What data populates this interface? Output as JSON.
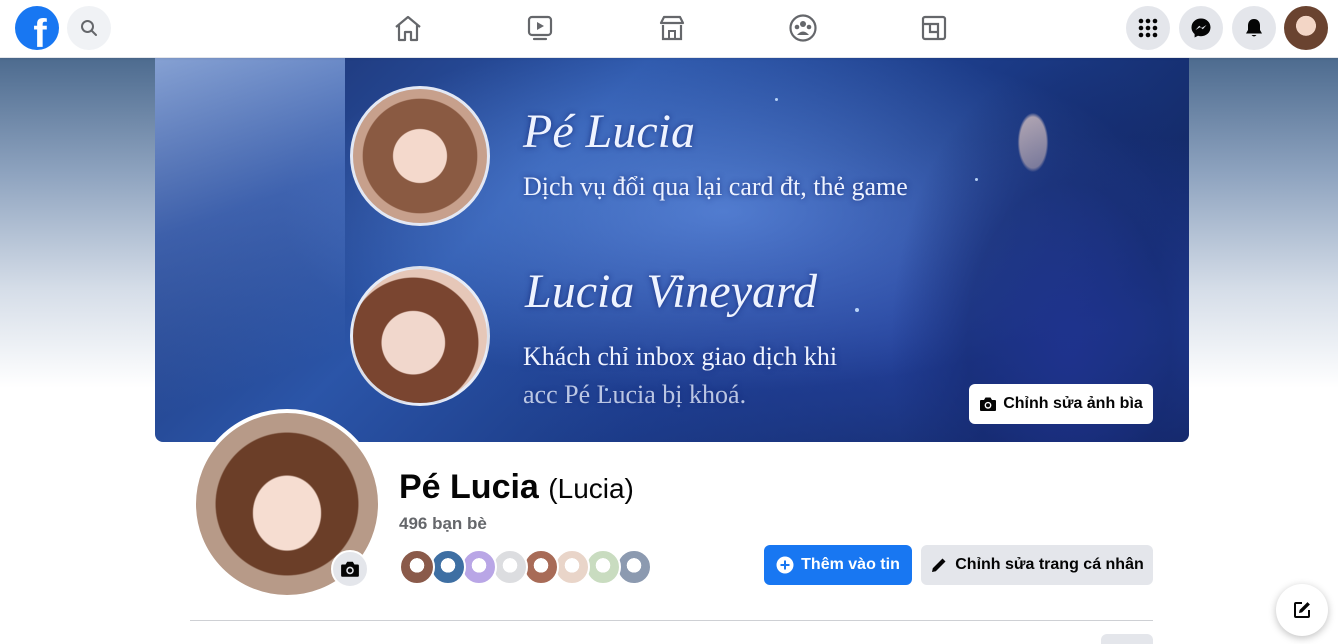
{
  "nav": {
    "logo_icon": "facebook-logo",
    "logo_letter": "f",
    "brand_color": "#1877f2",
    "center_icons": [
      "home-icon",
      "video-icon",
      "marketplace-icon",
      "groups-icon",
      "gaming-icon"
    ],
    "right_icons": [
      "menu-grid-icon",
      "messenger-icon",
      "notifications-icon"
    ]
  },
  "cover": {
    "title_1": "Pé Lucia",
    "subtitle_1": "Dịch vụ đổi qua lại card đt, thẻ game",
    "title_2": "Lucia Vineyard",
    "subtitle_2_line1": "Khách chỉ inbox giao dịch khi",
    "subtitle_2_line2": "acc Pé Lucia bị khoá.",
    "edit_cover_label": "Chỉnh sửa ảnh bìa"
  },
  "profile": {
    "name": "Pé Lucia",
    "alternate_name": "(Lucia)",
    "friends_count": "496 bạn bè",
    "add_story_label": "Thêm vào tin",
    "edit_profile_label": "Chỉnh sửa trang cá nhân",
    "friend_avatar_colors": [
      "#8a5a4a",
      "#3e6fa3",
      "#b9a6e6",
      "#dcdde0",
      "#a86b57",
      "#e9d5c9",
      "#c9dcc0",
      "#8c9ab0"
    ]
  }
}
